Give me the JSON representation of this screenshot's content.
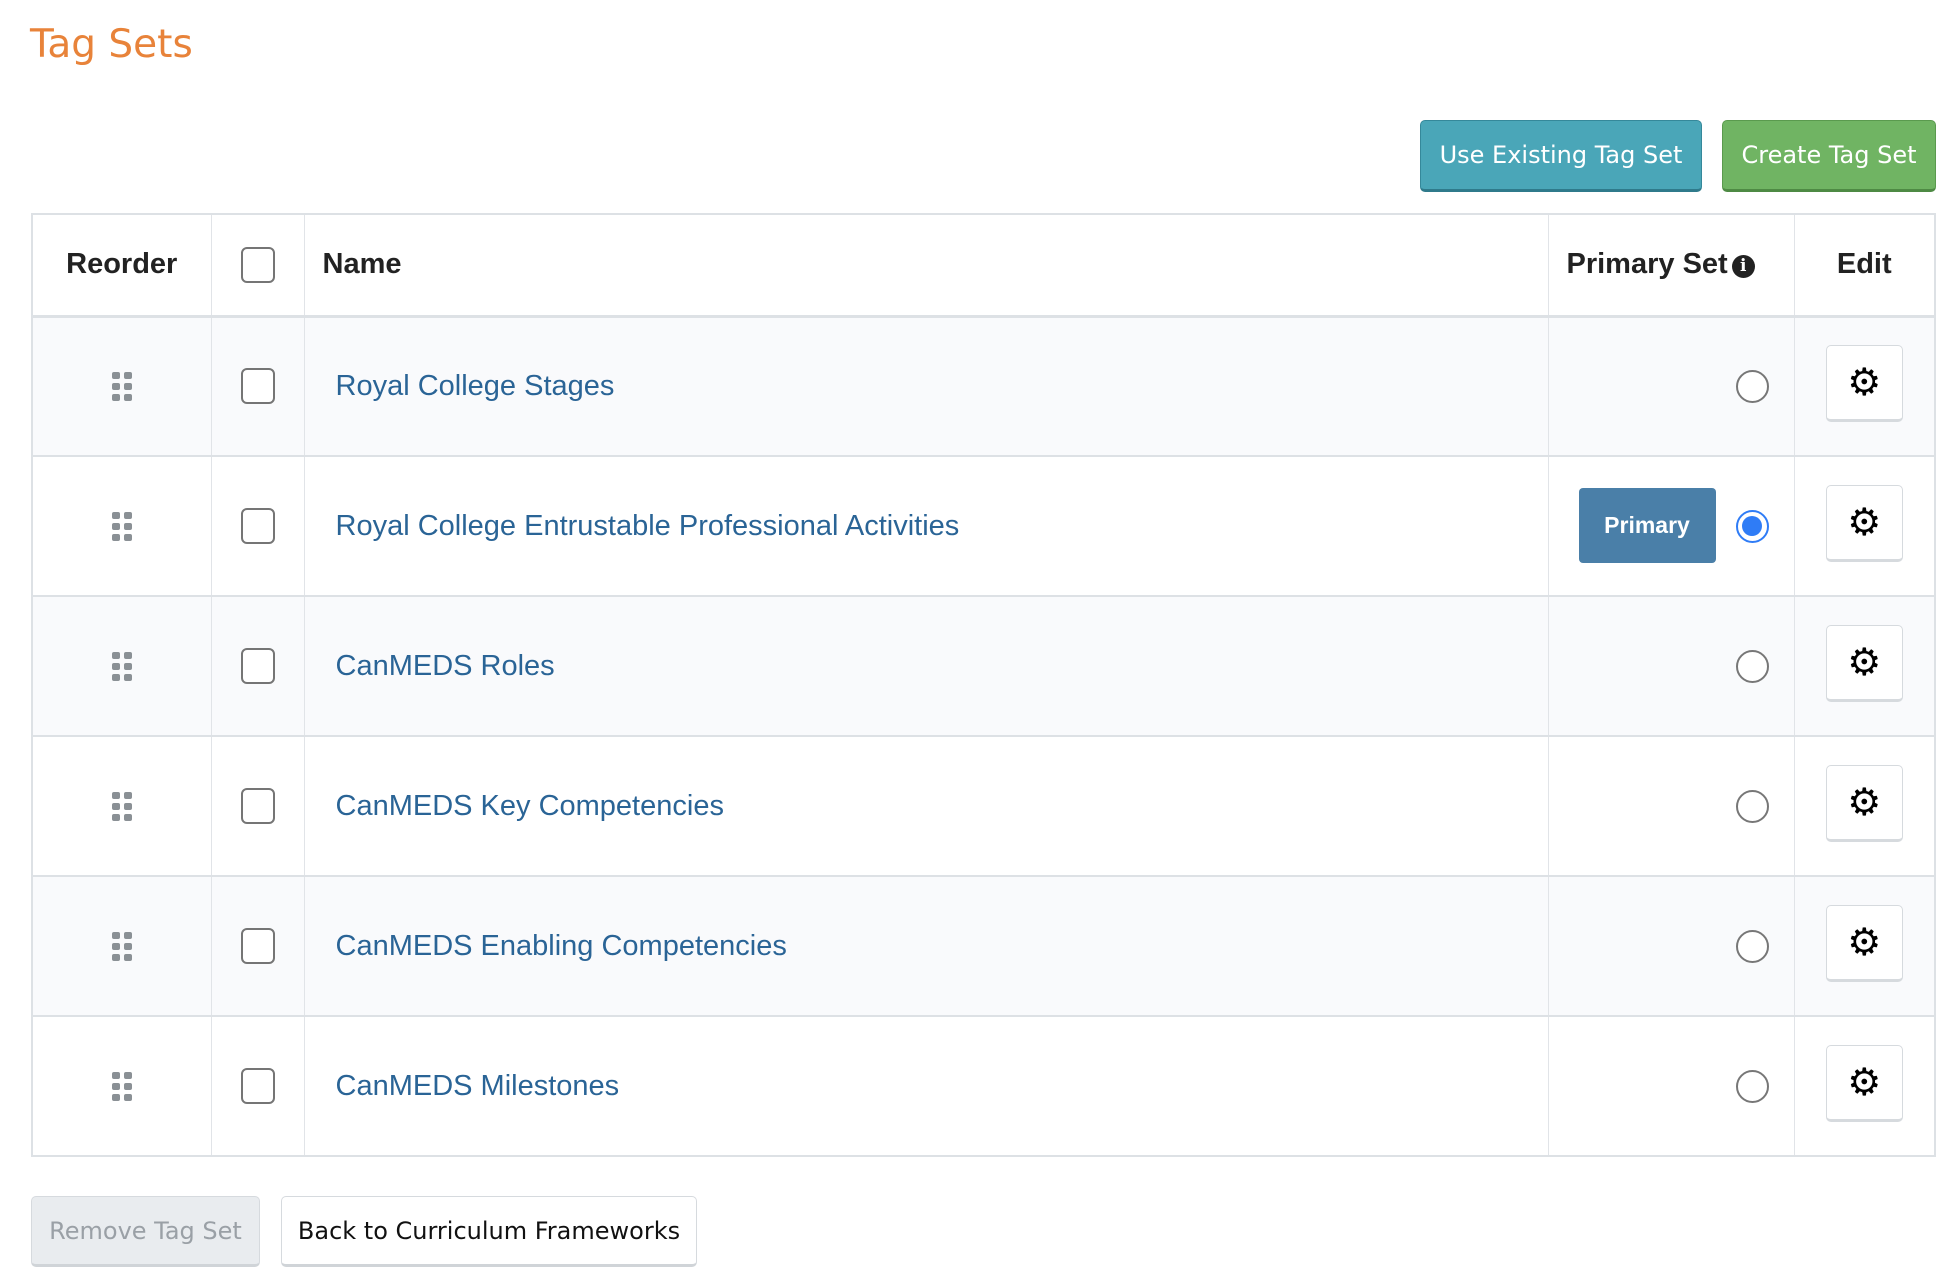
{
  "title": "Tag Sets",
  "toolbar": {
    "use_existing": "Use Existing Tag Set",
    "create": "Create Tag Set"
  },
  "table": {
    "headers": {
      "reorder": "Reorder",
      "name": "Name",
      "primary": "Primary Set",
      "edit": "Edit"
    },
    "primary_badge": "Primary",
    "rows": [
      {
        "name": "Royal College Stages",
        "primary": false
      },
      {
        "name": "Royal College Entrustable Professional Activities",
        "primary": true
      },
      {
        "name": "CanMEDS Roles",
        "primary": false
      },
      {
        "name": "CanMEDS Key Competencies",
        "primary": false
      },
      {
        "name": "CanMEDS Enabling Competencies",
        "primary": false
      },
      {
        "name": "CanMEDS Milestones",
        "primary": false
      }
    ]
  },
  "footer": {
    "remove": "Remove Tag Set",
    "back": "Back to Curriculum Frameworks"
  },
  "colors": {
    "title": "#e8833a",
    "info_button": "#4aa6b8",
    "success_button": "#70b463",
    "link": "#2a6496",
    "badge": "#4a7fa8"
  }
}
